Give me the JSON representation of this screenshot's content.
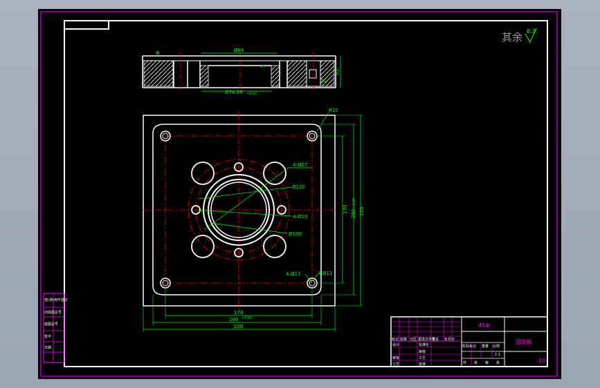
{
  "surface_finish": {
    "prefix": "其余",
    "value": "6.3"
  },
  "dims": {
    "top_dia_84": "Ø84",
    "top_note_left": "Φ",
    "side_dim_5": "5",
    "side_dim_10": "10",
    "side_dim_35": "35",
    "bore_dia": "Ø74.35",
    "bore_tol": "+0.02",
    "r10": "R10",
    "holes_27": "4-Ø27",
    "pcd_120": "Ø120",
    "holes_10": "4-Ø10",
    "bore_100": "Ø100",
    "holes_17": "4-Ø17",
    "holes_11": "4-Ø11",
    "v_170": "170",
    "v_200": "200",
    "v_200_tol": "+0.05",
    "v_220": "220",
    "h_170": "170",
    "h_200": "200",
    "h_200_tol": "+0.05",
    "h_220": "220"
  },
  "title_block": {
    "material": "45#",
    "part_name": "固定板",
    "drawing_no": "-10",
    "scale": "1:1",
    "left_labels": [
      "标记",
      "处数",
      "分区",
      "更改文件号",
      "签名",
      "年月日"
    ],
    "row_design": "设计",
    "row_std": "标准化",
    "row_check": "审核",
    "row_process": "工艺",
    "row_approve": "批准",
    "stage_labels": [
      "阶段标记",
      "重量",
      "比例"
    ],
    "sheet_labels": [
      "共",
      "张",
      "第",
      "张"
    ]
  },
  "side_panel": {
    "labels": [
      "借(通)用件登记",
      "旧底图总号",
      "底图总号",
      "签字",
      "日期"
    ]
  },
  "colors": {
    "outline": "#ffffff",
    "dimension": "#00ff00",
    "centerline": "#ff0000",
    "frame": "#ff00ff",
    "title_text": "#ff00ff"
  }
}
